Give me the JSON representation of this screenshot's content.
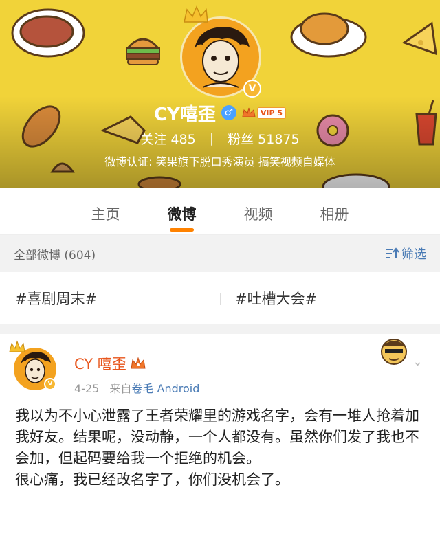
{
  "profile": {
    "nickname": "CY嘻歪",
    "vip_label": "VIP 5",
    "following_label": "关注",
    "following_count": "485",
    "stats_separator": "|",
    "followers_label": "粉丝",
    "followers_count": "51875",
    "verification": "微博认证: 笑果旗下脱口秀演员 搞笑视频自媒体"
  },
  "tabs": [
    {
      "label": "主页",
      "active": false
    },
    {
      "label": "微博",
      "active": true
    },
    {
      "label": "视频",
      "active": false
    },
    {
      "label": "相册",
      "active": false
    }
  ],
  "filter": {
    "count_label": "全部微博 (604)",
    "button_label": "筛选"
  },
  "topics": [
    "#喜剧周末#",
    "#吐槽大会#"
  ],
  "post": {
    "author": "CY 嘻歪",
    "date": "4-25",
    "source_prefix": "来自",
    "source": "卷毛 Android",
    "lines": [
      "我以为不小心泄露了王者荣耀里的游戏名字，会有一堆人抢着加我好友。结果呢，没动静，一个人都没有。虽然你们发了我也不会加，但起码要给我一个拒绝的机会。",
      "很心痛，我已经改名字了，你们没机会了。"
    ]
  },
  "colors": {
    "banner": "#f1d339",
    "accent_orange": "#ff8200",
    "link_blue": "#4a7bb5",
    "author_orange": "#e8551b"
  }
}
